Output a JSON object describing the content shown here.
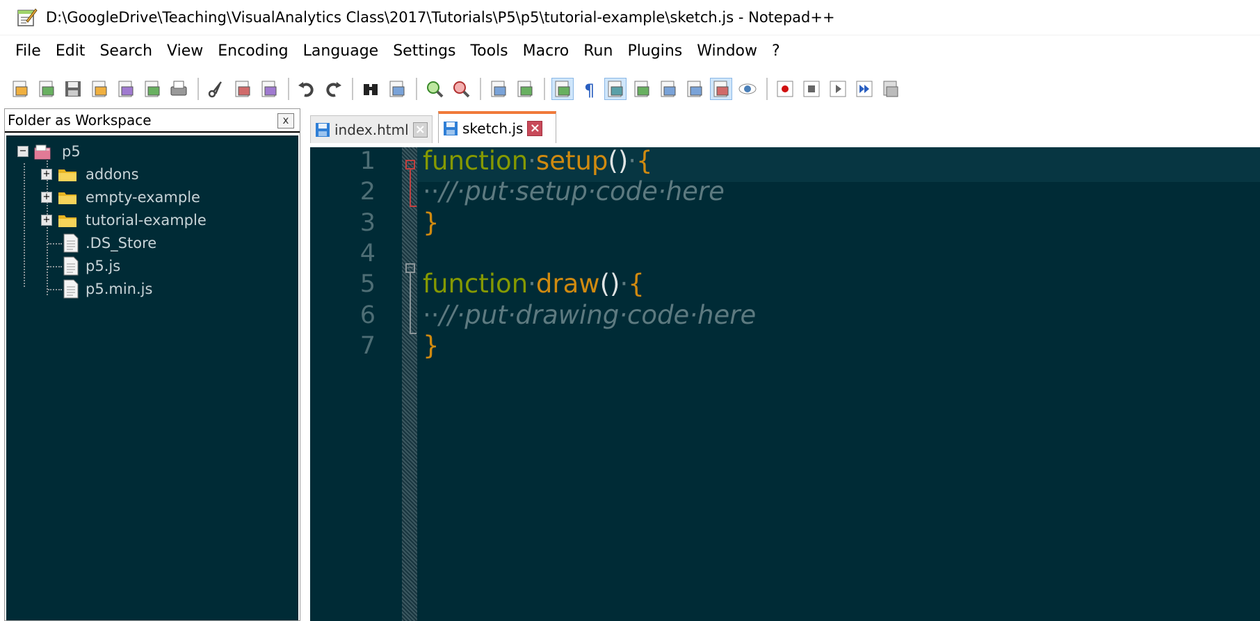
{
  "window": {
    "title": "D:\\GoogleDrive\\Teaching\\VisualAnalytics Class\\2017\\Tutorials\\P5\\p5\\tutorial-example\\sketch.js - Notepad++"
  },
  "menu": [
    "File",
    "Edit",
    "Search",
    "View",
    "Encoding",
    "Language",
    "Settings",
    "Tools",
    "Macro",
    "Run",
    "Plugins",
    "Window",
    "?"
  ],
  "toolbar": {
    "groups": [
      [
        "new-file-icon",
        "open-file-icon",
        "save-icon",
        "save-all-icon",
        "close-icon",
        "close-all-icon",
        "print-icon"
      ],
      [
        "cut-icon",
        "copy-icon",
        "paste-icon"
      ],
      [
        "undo-icon",
        "redo-icon"
      ],
      [
        "find-icon",
        "replace-icon"
      ],
      [
        "zoom-in-icon",
        "zoom-out-icon"
      ],
      [
        "sync-vertical-icon",
        "sync-horizontal-icon"
      ],
      [
        "word-wrap-icon",
        "show-all-chars-icon",
        "indent-guide-icon",
        "udl-icon",
        "doc-map-icon",
        "function-list-icon",
        "folder-workspace-icon",
        "monitor-icon"
      ],
      [
        "record-macro-icon",
        "stop-record-icon",
        "play-macro-icon",
        "run-macro-multiple-icon",
        "save-macro-icon"
      ]
    ]
  },
  "workspace": {
    "title": "Folder as Workspace",
    "close_label": "x",
    "root": "p5",
    "folders": [
      "addons",
      "empty-example",
      "tutorial-example"
    ],
    "files": [
      ".DS_Store",
      "p5.js",
      "p5.min.js"
    ]
  },
  "tabs": [
    {
      "label": "index.html",
      "active": false
    },
    {
      "label": "sketch.js",
      "active": true
    }
  ],
  "editor": {
    "line_numbers": [
      "1",
      "2",
      "3",
      "4",
      "5",
      "6",
      "7"
    ],
    "lines": [
      [
        {
          "t": "kw",
          "v": "function"
        },
        {
          "t": "ws",
          "v": "·"
        },
        {
          "t": "fn",
          "v": "setup"
        },
        {
          "t": "pn",
          "v": "()"
        },
        {
          "t": "ws",
          "v": "·"
        },
        {
          "t": "fn",
          "v": "{"
        }
      ],
      [
        {
          "t": "ws",
          "v": "··"
        },
        {
          "t": "cm",
          "v": "//·put·setup·code·here"
        }
      ],
      [
        {
          "t": "fn",
          "v": "}"
        }
      ],
      [],
      [
        {
          "t": "kw",
          "v": "function"
        },
        {
          "t": "ws",
          "v": "·"
        },
        {
          "t": "fn",
          "v": "draw"
        },
        {
          "t": "pn",
          "v": "()"
        },
        {
          "t": "ws",
          "v": "·"
        },
        {
          "t": "fn",
          "v": "{"
        }
      ],
      [
        {
          "t": "ws",
          "v": "··"
        },
        {
          "t": "cm",
          "v": "//·put·drawing·code·here"
        }
      ],
      [
        {
          "t": "fn",
          "v": "}"
        }
      ]
    ]
  },
  "colors": {
    "editor_bg": "#002b36",
    "current_line": "#073642",
    "keyword": "#859900",
    "function": "#d08a10",
    "comment": "#5d7a80",
    "active_tab_accent": "#f07a3a"
  }
}
